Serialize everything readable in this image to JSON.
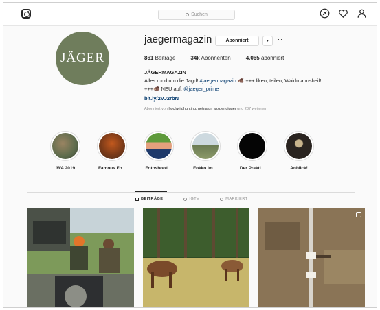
{
  "search": {
    "placeholder": "Suchen"
  },
  "profile": {
    "avatar_text": "JÄGER",
    "username": "jaegermagazin",
    "follow_label": "Abonniert",
    "dropdown_label": "▾",
    "more_label": "···",
    "stats": [
      {
        "count": "861",
        "label": "Beiträge"
      },
      {
        "count": "34k",
        "label": "Abonnenten"
      },
      {
        "count": "4.065",
        "label": "abonniert"
      }
    ],
    "full_name": "JÄGERMAGAZIN",
    "bio_line1_pre": "Alles rund um die Jagd! ",
    "bio_hashtag": "#jaegermagazin",
    "bio_line1_post": " 🐗 +++ liken, teilen, Waidmannsheil!",
    "bio_line2_pre": "+++🐗 NEU auf: ",
    "bio_mention": "@jaeger_prime",
    "link": "bit.ly/2VJ2rbN",
    "followed_by_pre": "Abonniert von ",
    "followed_by_names": "hochwildhunting, netnatur, woipendigger",
    "followed_by_post": " und 287 weiteren"
  },
  "highlights": [
    {
      "label": "IWA 2019",
      "colors": [
        "#5c6b4c",
        "#9a8462"
      ]
    },
    {
      "label": "Famous Fo...",
      "colors": [
        "#c2591e",
        "#4a2f1c"
      ]
    },
    {
      "label": "Fotoshooti...",
      "colors": [
        "#5e9a3b",
        "#1f3a6b"
      ]
    },
    {
      "label": "Fokko im ...",
      "colors": [
        "#cdd9df",
        "#6a7a52"
      ]
    },
    {
      "label": "Der Prakti...",
      "colors": [
        "#050505",
        "#1a1a1a"
      ]
    },
    {
      "label": "Anblick!",
      "colors": [
        "#2a2420",
        "#c9b58d"
      ]
    }
  ],
  "tabs": [
    {
      "label": "BEITRÄGE",
      "active": true
    },
    {
      "label": "IGTV",
      "active": false
    },
    {
      "label": "MARKIERT",
      "active": false
    }
  ],
  "colors": {
    "accent_link": "#00376b",
    "avatar_bg": "#6f7d5c"
  }
}
